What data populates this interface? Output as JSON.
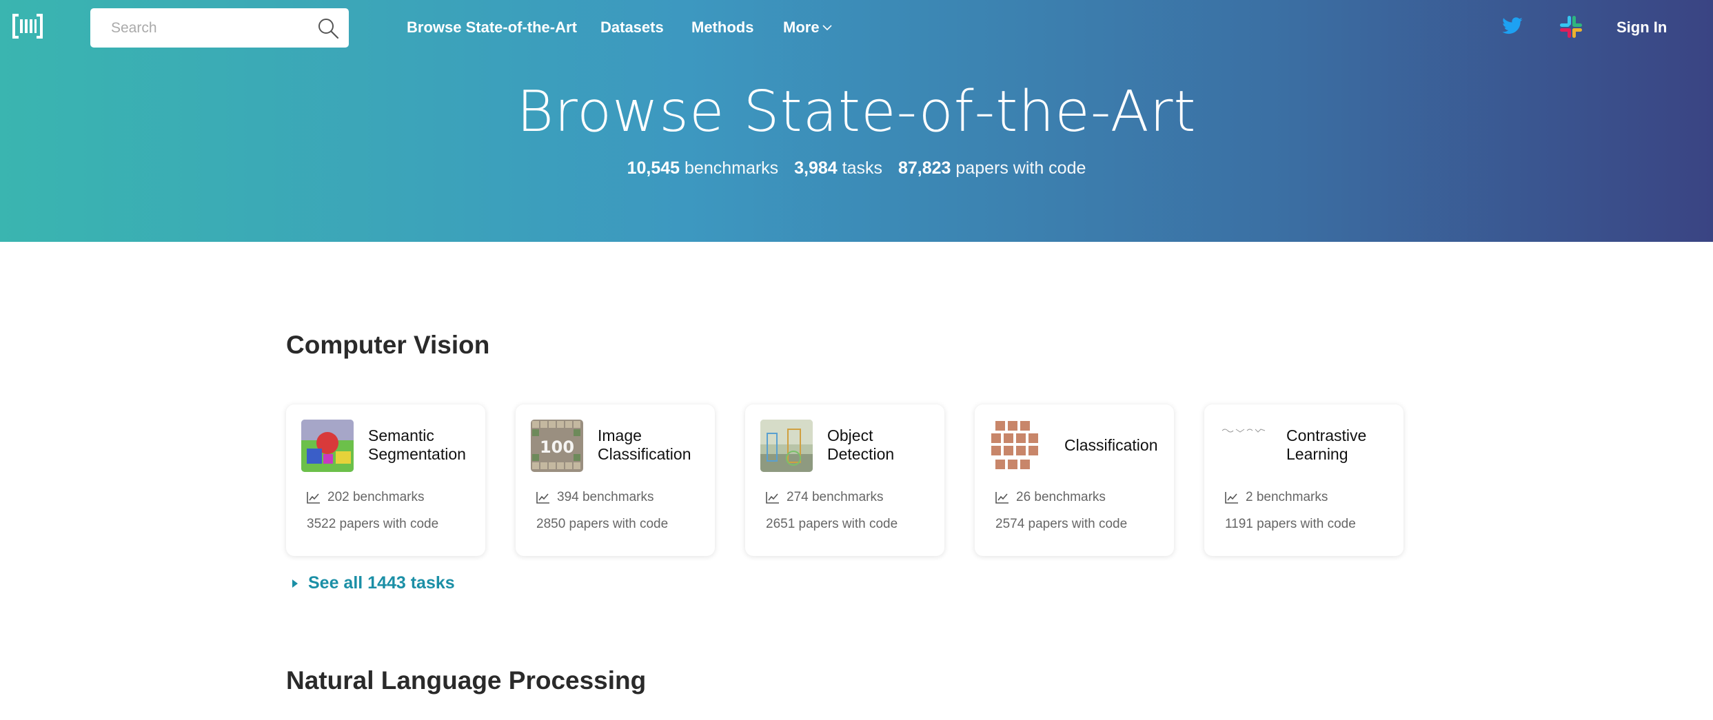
{
  "header": {
    "search_placeholder": "Search",
    "nav": {
      "browse": "Browse State-of-the-Art",
      "datasets": "Datasets",
      "methods": "Methods",
      "more": "More"
    },
    "sign_in": "Sign In"
  },
  "hero": {
    "title": "Browse State-of-the-Art",
    "stats": [
      {
        "num": "10,545",
        "label": "benchmarks"
      },
      {
        "num": "3,984",
        "label": "tasks"
      },
      {
        "num": "87,823",
        "label": "papers with code"
      }
    ]
  },
  "sections": {
    "cv": {
      "title": "Computer Vision",
      "see_all": "See all 1443 tasks",
      "tasks": [
        {
          "name": "Semantic Segmentation",
          "benchmarks": "202 benchmarks",
          "papers": "3522 papers with code"
        },
        {
          "name": "Image Classification",
          "benchmarks": "394 benchmarks",
          "papers": "2850 papers with code"
        },
        {
          "name": "Object Detection",
          "benchmarks": "274 benchmarks",
          "papers": "2651 papers with code"
        },
        {
          "name": "Classification",
          "benchmarks": "26 benchmarks",
          "papers": "2574 papers with code"
        },
        {
          "name": "Contrastive Learning",
          "benchmarks": "2 benchmarks",
          "papers": "1191 papers with code"
        }
      ]
    },
    "nlp": {
      "title": "Natural Language Processing"
    }
  },
  "icons": {
    "logo": "paperswithcode-logo-icon",
    "search": "search-icon",
    "twitter": "twitter-icon",
    "slack": "slack-icon",
    "chart": "chart-line-icon",
    "caret": "caret-right-icon"
  },
  "colors": {
    "hero_start": "#3ab5b0",
    "hero_end": "#3a4483",
    "link": "#1b8fa6",
    "twitter": "#1da1f2"
  }
}
